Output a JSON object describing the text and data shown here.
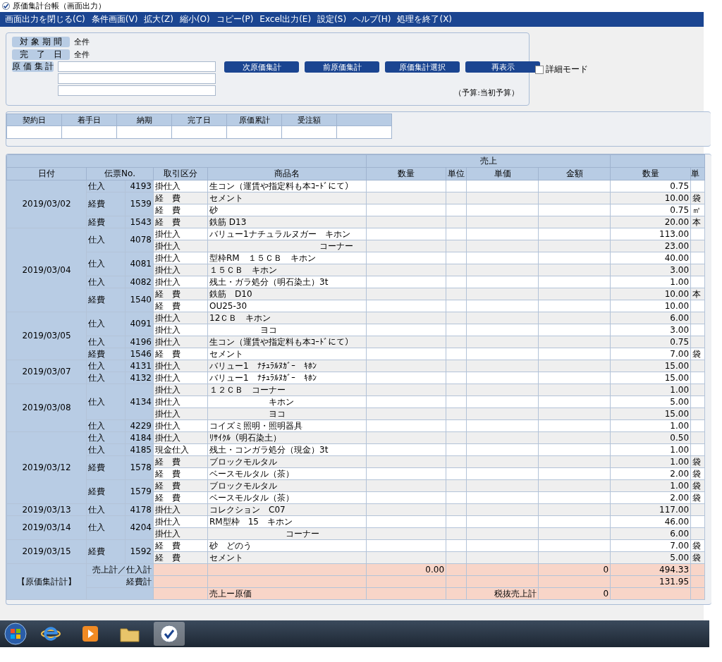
{
  "window": {
    "title": "原価集計台帳（画面出力）"
  },
  "menu": [
    "画面出力を閉じる(C)",
    "条件画面(V)",
    "拡大(Z)",
    "縮小(O)",
    "コピー(P)",
    "Excel出力(E)",
    "設定(S)",
    "ヘルプ(H)",
    "処理を終了(X)"
  ],
  "filters": [
    {
      "label": "対 象 期 間",
      "value": "全件"
    },
    {
      "label": "完　了　日",
      "value": "全件"
    },
    {
      "label": "原 価 集 計"
    }
  ],
  "buttons": [
    "次原価集計",
    "前原価集計",
    "原価集計選択",
    "再表示"
  ],
  "detail_mode": {
    "label": "詳細モード",
    "checked": false
  },
  "budget_note": "（予算:当初予算）",
  "summary_columns": [
    "契約日",
    "着手日",
    "納期",
    "完了日",
    "原価累計",
    "受注額"
  ],
  "table": {
    "group_header": "売上",
    "columns": [
      "日付",
      "伝票No.",
      "取引区分",
      "商品名",
      "数量",
      "単位",
      "単価",
      "金額",
      "数量",
      "単"
    ],
    "groups": [
      {
        "date": "2019/03/02",
        "vouchers": [
          {
            "type": "仕入",
            "number": "4193",
            "lines": [
              {
                "trade": "掛仕入",
                "item": "生コン（運賃や指定料も本ｺｰﾄﾞにて）",
                "qty": "0.75"
              }
            ]
          },
          {
            "type": "経費",
            "number": "1539",
            "lines": [
              {
                "trade": "経　費",
                "item": "セメント",
                "qty": "10.00",
                "unit": "袋"
              },
              {
                "trade": "経　費",
                "item": "砂",
                "qty": "0.75",
                "unit": "㎡"
              }
            ]
          },
          {
            "type": "経費",
            "number": "1543",
            "lines": [
              {
                "trade": "経　費",
                "item": "鉄筋 D13",
                "qty": "20.00",
                "unit": "本"
              }
            ]
          }
        ]
      },
      {
        "date": "2019/03/04",
        "vouchers": [
          {
            "type": "仕入",
            "number": "4078",
            "lines": [
              {
                "trade": "掛仕入",
                "item": "バリュー1ナチュラルヌガー　キホン",
                "qty": "113.00"
              },
              {
                "trade": "掛仕入",
                "item": "　　　　　　　　　　　　　コーナー",
                "qty": "23.00"
              }
            ]
          },
          {
            "type": "仕入",
            "number": "4081",
            "lines": [
              {
                "trade": "掛仕入",
                "item": "型枠RM　１５ＣＢ　キホン",
                "qty": "40.00"
              },
              {
                "trade": "掛仕入",
                "item": "１５ＣＢ　キホン",
                "qty": "3.00"
              }
            ]
          },
          {
            "type": "仕入",
            "number": "4082",
            "lines": [
              {
                "trade": "掛仕入",
                "item": "残土・ガラ処分（明石染土）3t",
                "qty": "1.00"
              }
            ]
          },
          {
            "type": "経費",
            "number": "1540",
            "lines": [
              {
                "trade": "経　費",
                "item": "鉄筋　D10",
                "qty": "10.00",
                "unit": "本"
              },
              {
                "trade": "経　費",
                "item": "OU25-30",
                "qty": "10.00"
              }
            ]
          }
        ]
      },
      {
        "date": "2019/03/05",
        "vouchers": [
          {
            "type": "仕入",
            "number": "4091",
            "lines": [
              {
                "trade": "掛仕入",
                "item": "12ＣＢ　キホン",
                "qty": "6.00"
              },
              {
                "trade": "掛仕入",
                "item": "　　　　　　ヨコ",
                "qty": "3.00"
              }
            ]
          },
          {
            "type": "仕入",
            "number": "4196",
            "lines": [
              {
                "trade": "掛仕入",
                "item": "生コン（運賃や指定料も本ｺｰﾄﾞにて）",
                "qty": "0.75"
              }
            ]
          },
          {
            "type": "経費",
            "number": "1546",
            "lines": [
              {
                "trade": "経　費",
                "item": "セメント",
                "qty": "7.00",
                "unit": "袋"
              }
            ]
          }
        ]
      },
      {
        "date": "2019/03/07",
        "vouchers": [
          {
            "type": "仕入",
            "number": "4131",
            "lines": [
              {
                "trade": "掛仕入",
                "item": "バリュー1　ﾅﾁｭﾗﾙﾇｶﾞｰ　ｷﾎﾝ",
                "qty": "15.00"
              }
            ]
          },
          {
            "type": "仕入",
            "number": "4132",
            "lines": [
              {
                "trade": "掛仕入",
                "item": "バリュー1　ﾅﾁｭﾗﾙﾇｶﾞｰ　ｷﾎﾝ",
                "qty": "15.00"
              }
            ]
          }
        ]
      },
      {
        "date": "2019/03/08",
        "vouchers": [
          {
            "type": "仕入",
            "number": "4134",
            "lines": [
              {
                "trade": "掛仕入",
                "item": "１２ＣＢ　コーナー",
                "qty": "1.00"
              },
              {
                "trade": "掛仕入",
                "item": "　　　　　　　キホン",
                "qty": "5.00"
              },
              {
                "trade": "掛仕入",
                "item": "　　　　　　　ヨコ",
                "qty": "15.00"
              }
            ]
          },
          {
            "type": "仕入",
            "number": "4229",
            "lines": [
              {
                "trade": "掛仕入",
                "item": "コイズミ照明・照明器具",
                "qty": "1.00"
              }
            ]
          }
        ]
      },
      {
        "date": "2019/03/12",
        "vouchers": [
          {
            "type": "仕入",
            "number": "4184",
            "lines": [
              {
                "trade": "掛仕入",
                "item": "ﾘｻｲｸﾙ（明石染土）",
                "qty": "0.50"
              }
            ]
          },
          {
            "type": "仕入",
            "number": "4185",
            "lines": [
              {
                "trade": "現金仕入",
                "item": "残土・コンガラ処分（現金）3t",
                "qty": "1.00"
              }
            ]
          },
          {
            "type": "経費",
            "number": "1578",
            "lines": [
              {
                "trade": "経　費",
                "item": "ブロックモルタル",
                "qty": "1.00",
                "unit": "袋"
              },
              {
                "trade": "経　費",
                "item": "ベースモルタル（茶）",
                "qty": "2.00",
                "unit": "袋"
              }
            ]
          },
          {
            "type": "経費",
            "number": "1579",
            "lines": [
              {
                "trade": "経　費",
                "item": "ブロックモルタル",
                "qty": "1.00",
                "unit": "袋"
              },
              {
                "trade": "経　費",
                "item": "ベースモルタル（茶）",
                "qty": "2.00",
                "unit": "袋"
              }
            ]
          }
        ]
      },
      {
        "date": "2019/03/13",
        "vouchers": [
          {
            "type": "仕入",
            "number": "4178",
            "lines": [
              {
                "trade": "掛仕入",
                "item": "コレクション　C07",
                "qty": "117.00"
              }
            ]
          }
        ]
      },
      {
        "date": "2019/03/14",
        "vouchers": [
          {
            "type": "仕入",
            "number": "4204",
            "lines": [
              {
                "trade": "掛仕入",
                "item": "RM型枠　15　キホン",
                "qty": "46.00"
              },
              {
                "trade": "掛仕入",
                "item": "　　　　　　　　　コーナー",
                "qty": "6.00"
              }
            ]
          }
        ]
      },
      {
        "date": "2019/03/15",
        "vouchers": [
          {
            "type": "経費",
            "number": "1592",
            "lines": [
              {
                "trade": "経　費",
                "item": "砂　どのう",
                "qty": "7.00",
                "unit": "袋"
              },
              {
                "trade": "経　費",
                "item": "セメント",
                "qty": "5.00",
                "unit": "袋"
              }
            ]
          }
        ]
      }
    ],
    "totals": {
      "title": "【原価集計計】",
      "rows": [
        {
          "label": "売上計／仕入計",
          "sales_qty": "0.00",
          "sales_amount": "0",
          "purchase_qty": "494.33"
        },
        {
          "label": "経費計",
          "purchase_qty": "131.95"
        },
        {
          "item": "売上ー原価",
          "price_label": "税抜売上計",
          "sales_amount": "0"
        }
      ]
    }
  }
}
